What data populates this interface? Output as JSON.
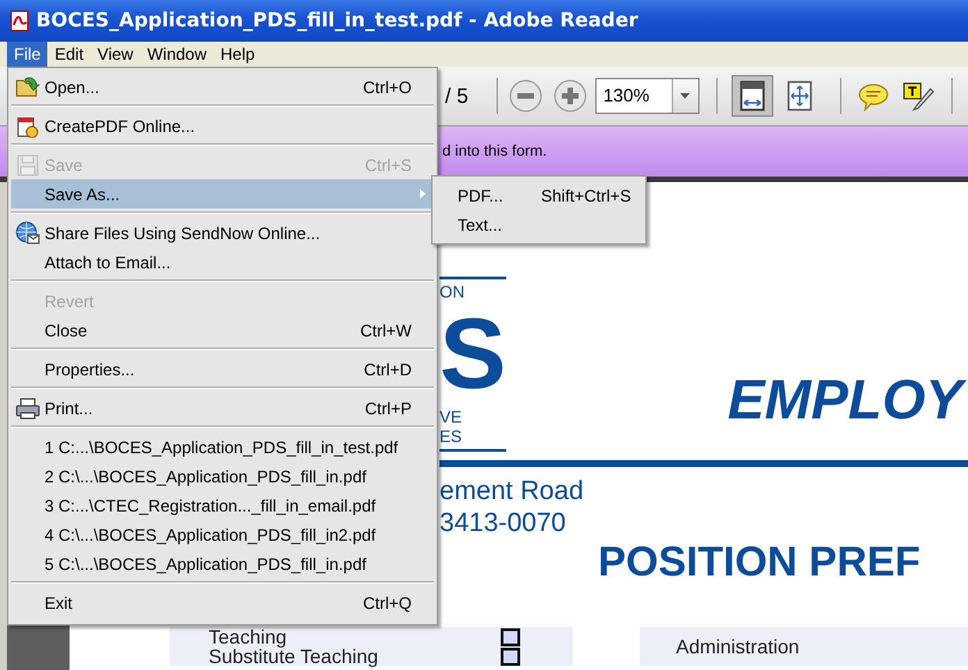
{
  "window": {
    "title": "BOCES_Application_PDS_fill_in_test.pdf - Adobe Reader"
  },
  "menubar": [
    {
      "label": "File",
      "selected": true
    },
    {
      "label": "Edit",
      "selected": false
    },
    {
      "label": "View",
      "selected": false
    },
    {
      "label": "Window",
      "selected": false
    },
    {
      "label": "Help",
      "selected": false
    }
  ],
  "toolbar": {
    "page_total": "/ 5",
    "zoom": "130%",
    "view_tools": [
      {
        "selected": true
      },
      {
        "selected": false
      }
    ]
  },
  "message_bar": {
    "text": "d into this form."
  },
  "file_menu": {
    "groups": [
      [
        {
          "label": "Open...",
          "shortcut": "Ctrl+O",
          "disabled": false,
          "selected": false,
          "submenu": false
        }
      ],
      [
        {
          "label": "CreatePDF Online...",
          "disabled": false,
          "selected": false,
          "submenu": false
        }
      ],
      [
        {
          "label": "Save",
          "shortcut": "Ctrl+S",
          "disabled": true,
          "selected": false,
          "submenu": false
        },
        {
          "label": "Save As...",
          "disabled": false,
          "selected": true,
          "submenu": true
        }
      ],
      [
        {
          "label": "Share Files Using SendNow Online...",
          "disabled": false,
          "selected": false,
          "submenu": false
        },
        {
          "label": "Attach to Email...",
          "disabled": false,
          "selected": false,
          "submenu": false
        }
      ],
      [
        {
          "label": "Revert",
          "disabled": true,
          "selected": false,
          "submenu": false
        },
        {
          "label": "Close",
          "shortcut": "Ctrl+W",
          "disabled": false,
          "selected": false,
          "submenu": false
        }
      ],
      [
        {
          "label": "Properties...",
          "shortcut": "Ctrl+D",
          "disabled": false,
          "selected": false,
          "submenu": false
        }
      ],
      [
        {
          "label": "Print...",
          "shortcut": "Ctrl+P",
          "disabled": false,
          "selected": false,
          "submenu": false
        }
      ],
      [
        {
          "label": "1 C:...\\BOCES_Application_PDS_fill_in_test.pdf",
          "disabled": false,
          "selected": false,
          "submenu": false
        },
        {
          "label": "2 C:\\...\\BOCES_Application_PDS_fill_in.pdf",
          "disabled": false,
          "selected": false,
          "submenu": false
        },
        {
          "label": "3 C:...\\CTEC_Registration..._fill_in_email.pdf",
          "disabled": false,
          "selected": false,
          "submenu": false
        },
        {
          "label": "4 C:\\...\\BOCES_Application_PDS_fill_in2.pdf",
          "disabled": false,
          "selected": false,
          "submenu": false
        },
        {
          "label": "5 C:\\...\\BOCES_Application_PDS_fill_in.pdf",
          "disabled": false,
          "selected": false,
          "submenu": false
        }
      ],
      [
        {
          "label": "Exit",
          "shortcut": "Ctrl+Q",
          "disabled": false,
          "selected": false,
          "submenu": false
        }
      ]
    ]
  },
  "save_as_submenu": [
    {
      "label": "PDF...",
      "shortcut": "Shift+Ctrl+S"
    },
    {
      "label": "Text..."
    }
  ],
  "document": {
    "logo_text": [
      "ON",
      "S",
      "VE",
      "ES"
    ],
    "heading": "EMPLOY",
    "address": [
      "ement Road",
      "3413-0070"
    ],
    "section_title": "POSITION PREF",
    "positions_left": [
      {
        "label": "Teaching",
        "checked": false
      },
      {
        "label": "Substitute Teaching",
        "checked": false
      }
    ],
    "positions_right": [
      {
        "label": "Administration"
      }
    ]
  }
}
